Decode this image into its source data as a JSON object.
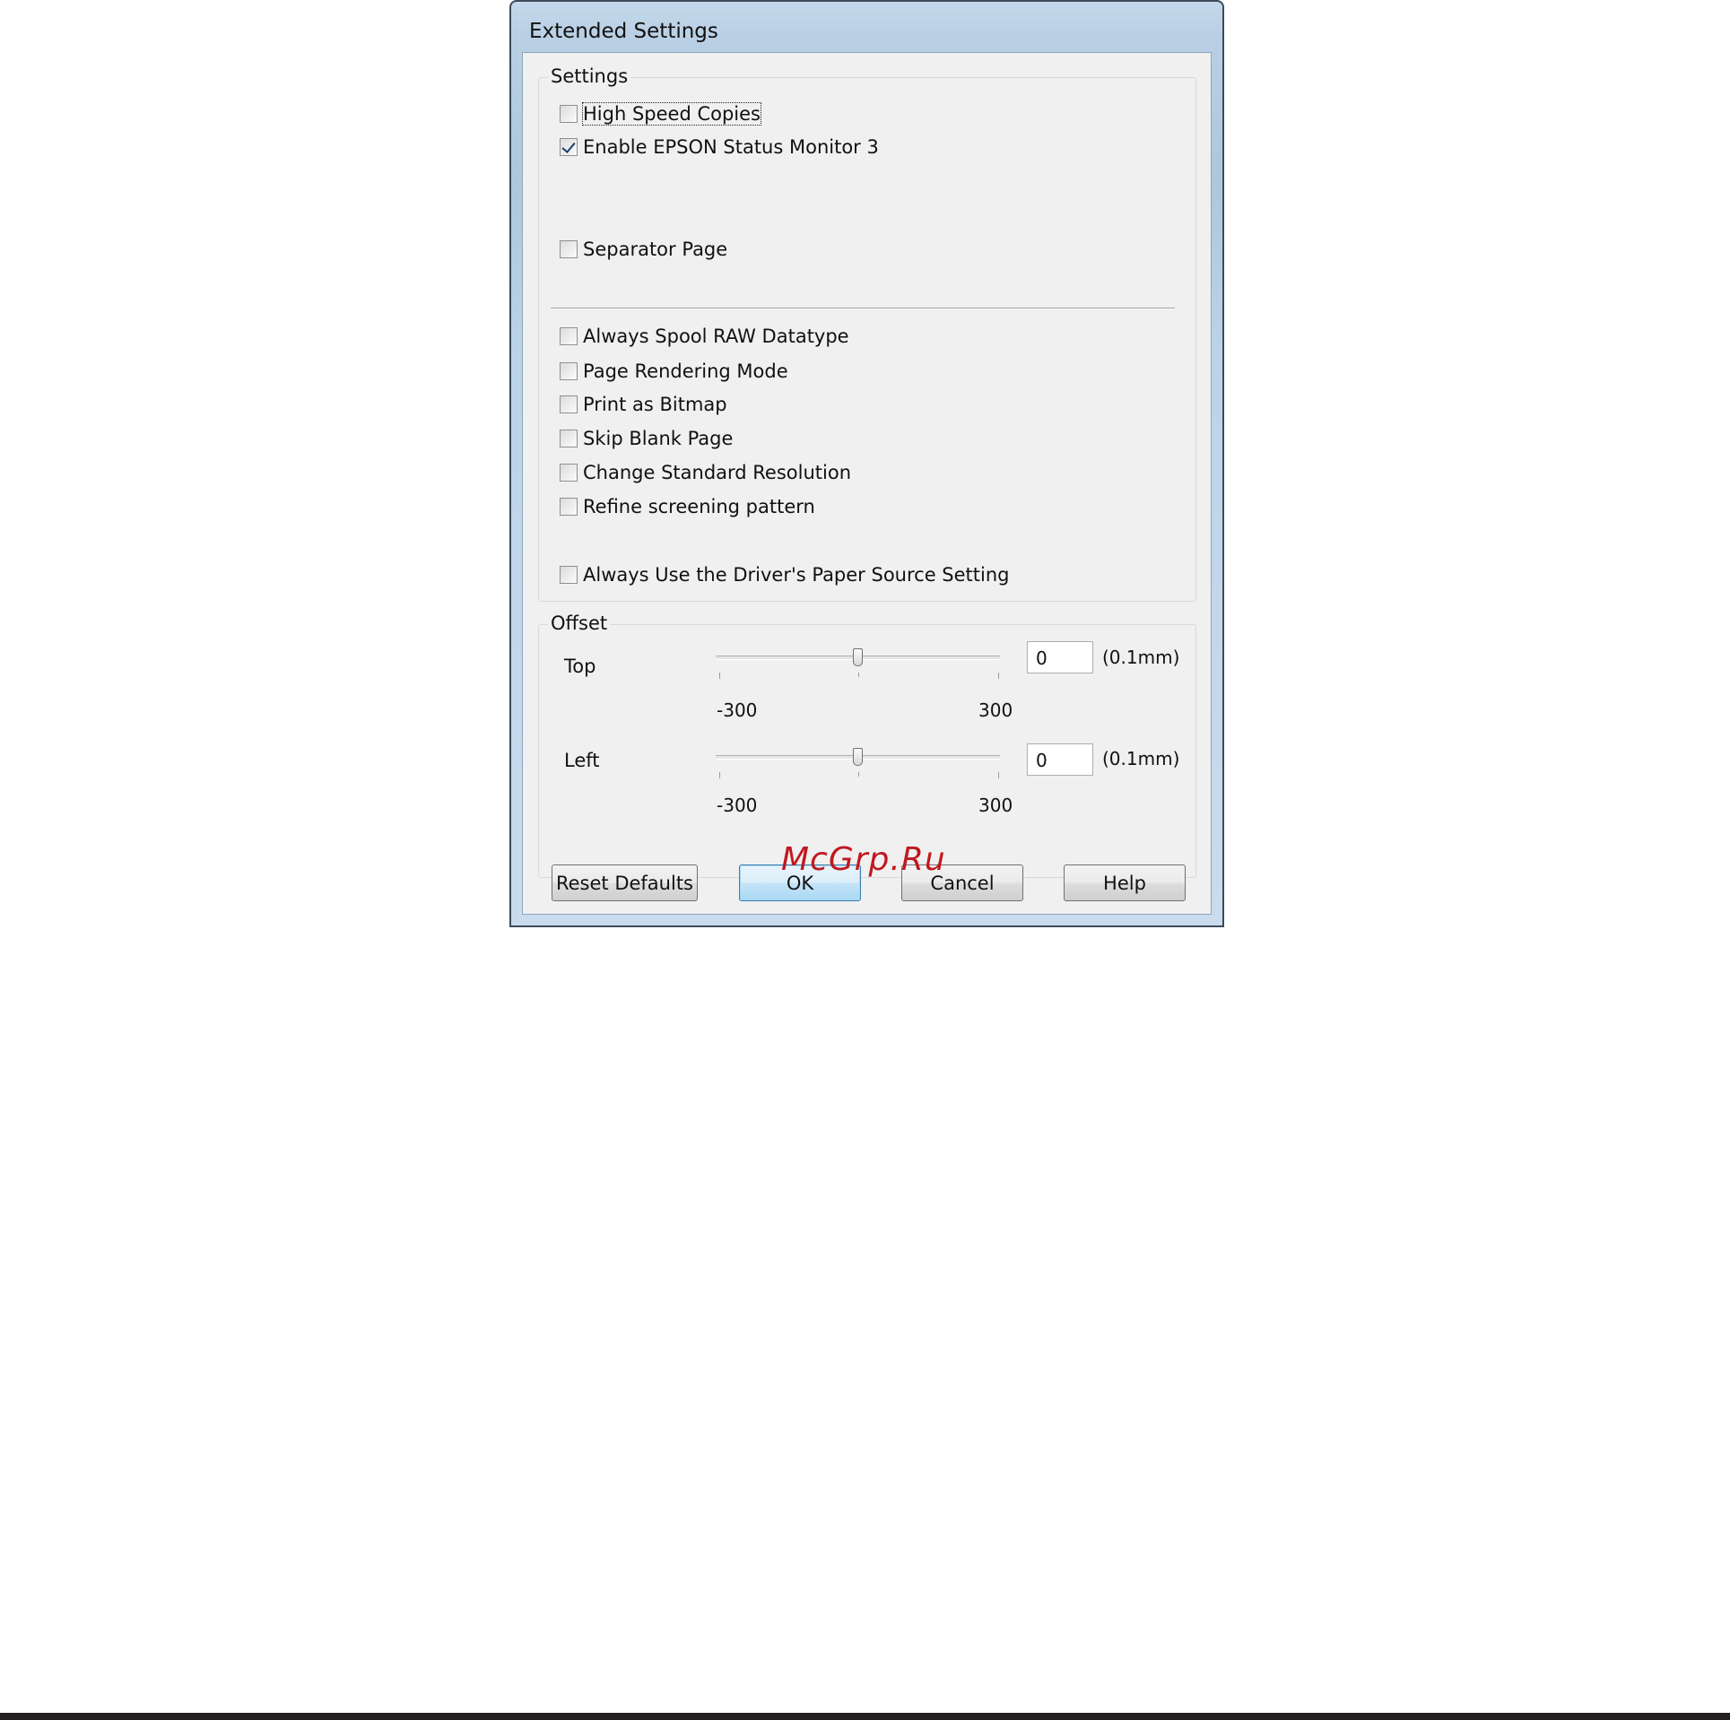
{
  "window": {
    "title": "Extended Settings"
  },
  "settings_group": {
    "label": "Settings",
    "checkboxes": [
      {
        "label": "High Speed Copies",
        "checked": false,
        "focused": true
      },
      {
        "label": "Enable EPSON Status Monitor 3",
        "checked": true
      },
      {
        "label": "Separator Page",
        "checked": false
      },
      {
        "label": "Always Spool RAW Datatype",
        "checked": false
      },
      {
        "label": "Page Rendering Mode",
        "checked": false
      },
      {
        "label": "Print as Bitmap",
        "checked": false
      },
      {
        "label": "Skip Blank Page",
        "checked": false
      },
      {
        "label": "Change Standard Resolution",
        "checked": false
      },
      {
        "label": "Refine screening pattern",
        "checked": false
      },
      {
        "label": "Always Use the Driver's Paper Source Setting",
        "checked": false
      }
    ]
  },
  "offset_group": {
    "label": "Offset",
    "top": {
      "label": "Top",
      "value": "0",
      "unit": "(0.1mm)",
      "min_label": "-300",
      "max_label": "300",
      "slider_value": 0
    },
    "left": {
      "label": "Left",
      "value": "0",
      "unit": "(0.1mm)",
      "min_label": "-300",
      "max_label": "300",
      "slider_value": 0
    }
  },
  "buttons": {
    "reset": "Reset Defaults",
    "ok": "OK",
    "cancel": "Cancel",
    "help": "Help"
  },
  "watermark": "McGrp.Ru",
  "colors": {
    "window_frame": "#b9cfe4",
    "client_bg": "#f0f0f0",
    "default_button": "#a9d9f5",
    "watermark": "#c0181f"
  }
}
